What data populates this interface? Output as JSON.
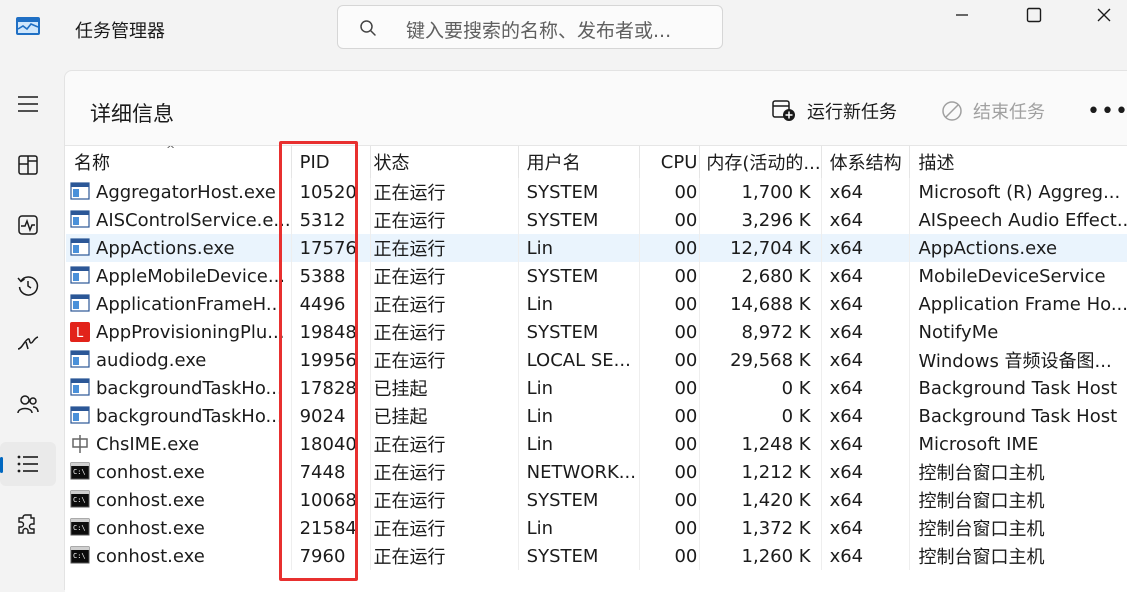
{
  "window": {
    "title": "任务管理器",
    "search_placeholder": "键入要搜索的名称、发布者或..."
  },
  "sidebar": {
    "items": [
      {
        "name": "menu-icon"
      },
      {
        "name": "processes-icon"
      },
      {
        "name": "performance-icon"
      },
      {
        "name": "app-history-icon"
      },
      {
        "name": "startup-icon"
      },
      {
        "name": "users-icon"
      },
      {
        "name": "details-icon",
        "active": true
      },
      {
        "name": "services-icon"
      }
    ]
  },
  "header": {
    "page_title": "详细信息",
    "run_new_task": "运行新任务",
    "end_task": "结束任务",
    "more": "•••"
  },
  "table": {
    "columns": [
      "名称",
      "PID",
      "状态",
      "用户名",
      "CPU",
      "内存(活动的...",
      "体系结构",
      "描述"
    ],
    "rows": [
      {
        "name": "AggregatorHost.exe",
        "pid": "10520",
        "status": "正在运行",
        "user": "SYSTEM",
        "cpu": "00",
        "mem": "1,700 K",
        "arch": "x64",
        "desc": "Microsoft (R) Aggreg...",
        "icon": "window"
      },
      {
        "name": "AISControlService.e...",
        "pid": "5312",
        "status": "正在运行",
        "user": "SYSTEM",
        "cpu": "00",
        "mem": "3,296 K",
        "arch": "x64",
        "desc": "AISpeech Audio Effect...",
        "icon": "window"
      },
      {
        "name": "AppActions.exe",
        "pid": "17576",
        "status": "正在运行",
        "user": "Lin",
        "cpu": "00",
        "mem": "12,704 K",
        "arch": "x64",
        "desc": "AppActions.exe",
        "icon": "window",
        "selected": true
      },
      {
        "name": "AppleMobileDevice...",
        "pid": "5388",
        "status": "正在运行",
        "user": "SYSTEM",
        "cpu": "00",
        "mem": "2,680 K",
        "arch": "x64",
        "desc": "MobileDeviceService",
        "icon": "window"
      },
      {
        "name": "ApplicationFrameH...",
        "pid": "4496",
        "status": "正在运行",
        "user": "Lin",
        "cpu": "00",
        "mem": "14,688 K",
        "arch": "x64",
        "desc": "Application Frame Ho...",
        "icon": "window"
      },
      {
        "name": "AppProvisioningPlu...",
        "pid": "19848",
        "status": "正在运行",
        "user": "SYSTEM",
        "cpu": "00",
        "mem": "8,972 K",
        "arch": "x64",
        "desc": "NotifyMe",
        "icon": "lenovo"
      },
      {
        "name": "audiodg.exe",
        "pid": "19956",
        "status": "正在运行",
        "user": "LOCAL SE...",
        "cpu": "00",
        "mem": "29,568 K",
        "arch": "x64",
        "desc": "Windows 音频设备图...",
        "icon": "window"
      },
      {
        "name": "backgroundTaskHo...",
        "pid": "17828",
        "status": "已挂起",
        "user": "Lin",
        "cpu": "00",
        "mem": "0 K",
        "arch": "x64",
        "desc": "Background Task Host",
        "icon": "window"
      },
      {
        "name": "backgroundTaskHo...",
        "pid": "9024",
        "status": "已挂起",
        "user": "Lin",
        "cpu": "00",
        "mem": "0 K",
        "arch": "x64",
        "desc": "Background Task Host",
        "icon": "window"
      },
      {
        "name": "ChsIME.exe",
        "pid": "18040",
        "status": "正在运行",
        "user": "Lin",
        "cpu": "00",
        "mem": "1,248 K",
        "arch": "x64",
        "desc": "Microsoft IME",
        "icon": "ime"
      },
      {
        "name": "conhost.exe",
        "pid": "7448",
        "status": "正在运行",
        "user": "NETWORK...",
        "cpu": "00",
        "mem": "1,212 K",
        "arch": "x64",
        "desc": "控制台窗口主机",
        "icon": "console"
      },
      {
        "name": "conhost.exe",
        "pid": "10068",
        "status": "正在运行",
        "user": "SYSTEM",
        "cpu": "00",
        "mem": "1,420 K",
        "arch": "x64",
        "desc": "控制台窗口主机",
        "icon": "console"
      },
      {
        "name": "conhost.exe",
        "pid": "21584",
        "status": "正在运行",
        "user": "Lin",
        "cpu": "00",
        "mem": "1,372 K",
        "arch": "x64",
        "desc": "控制台窗口主机",
        "icon": "console"
      },
      {
        "name": "conhost.exe",
        "pid": "7960",
        "status": "正在运行",
        "user": "SYSTEM",
        "cpu": "00",
        "mem": "1,260 K",
        "arch": "x64",
        "desc": "控制台窗口主机",
        "icon": "console"
      }
    ]
  },
  "colors": {
    "accent": "#0067c0",
    "highlight_box": "#e8302f",
    "selected_row": "#eaf4fd"
  }
}
